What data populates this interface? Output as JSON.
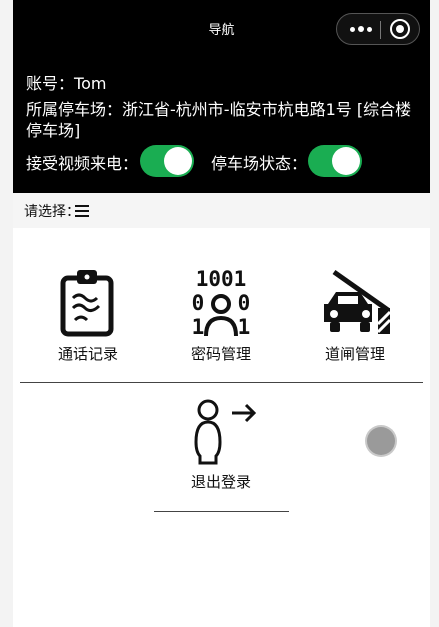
{
  "navbar": {
    "title": "导航"
  },
  "account": {
    "label": "账号：",
    "value": "Tom"
  },
  "parking": {
    "label": "所属停车场：",
    "value": "浙江省-杭州市-临安市杭电路1号 [综合楼停车场]"
  },
  "video_call": {
    "label": "接受视频来电：",
    "on": true
  },
  "lot_status": {
    "label": "停车场状态：",
    "on": true
  },
  "select": {
    "label": "请选择："
  },
  "menu": {
    "call_records": "通话记录",
    "password_mgmt": "密码管理",
    "gate_mgmt": "道闸管理",
    "logout": "退出登录"
  },
  "colors": {
    "switch_on": "#1aad52",
    "header_bg": "#000000"
  }
}
